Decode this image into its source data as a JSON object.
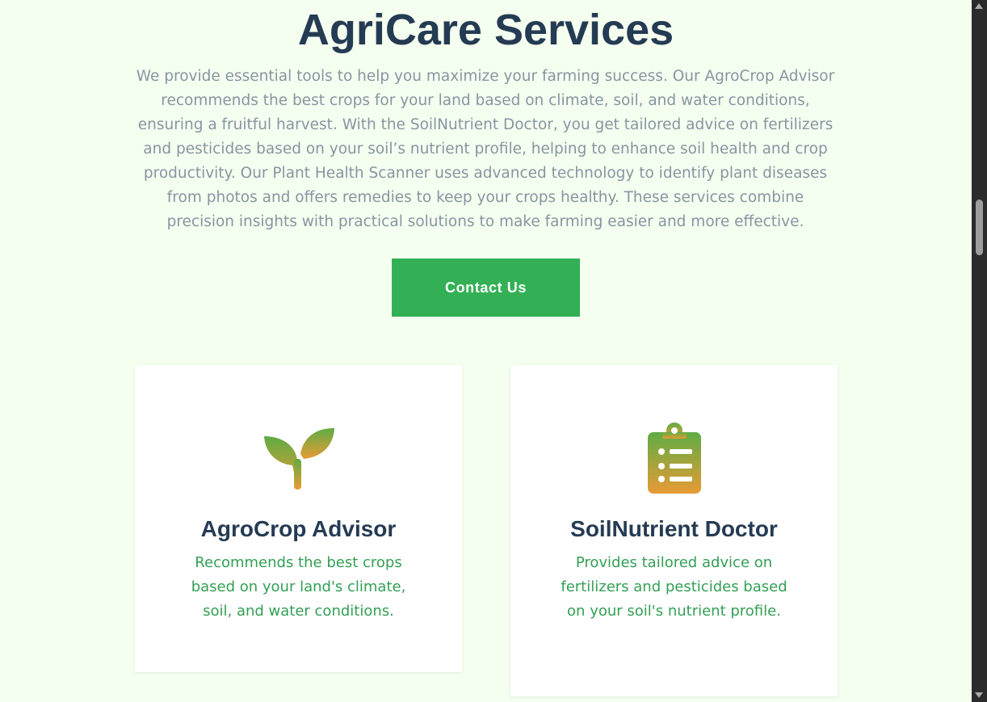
{
  "hero": {
    "title": "AgriCare Services",
    "description": "We provide essential tools to help you maximize your farming success. Our AgroCrop Advisor recommends the best crops for your land based on climate, soil, and water conditions, ensuring a fruitful harvest. With the SoilNutrient Doctor, you get tailored advice on fertilizers and pesticides based on your soil’s nutrient profile, helping to enhance soil health and crop productivity. Our Plant Health Scanner uses advanced technology to identify plant diseases from photos and offers remedies to keep your crops healthy. These services combine precision insights with practical solutions to make farming easier and more effective.",
    "cta_label": "Contact Us"
  },
  "services": [
    {
      "icon": "sprout-icon",
      "title": "AgroCrop Advisor",
      "text": "Recommends the best crops based on your land's climate, soil, and water conditions."
    },
    {
      "icon": "clipboard-list-icon",
      "title": "SoilNutrient Doctor",
      "text": "Provides tailored advice on fertilizers and pesticides based on your soil's nutrient profile."
    }
  ],
  "colors": {
    "background": "#f5fff0",
    "heading": "#243b53",
    "body_text": "#8795a1",
    "accent_green": "#33b055",
    "card_text": "#33a055",
    "icon_gradient_top": "#5fac45",
    "icon_gradient_bottom": "#e89b35"
  }
}
